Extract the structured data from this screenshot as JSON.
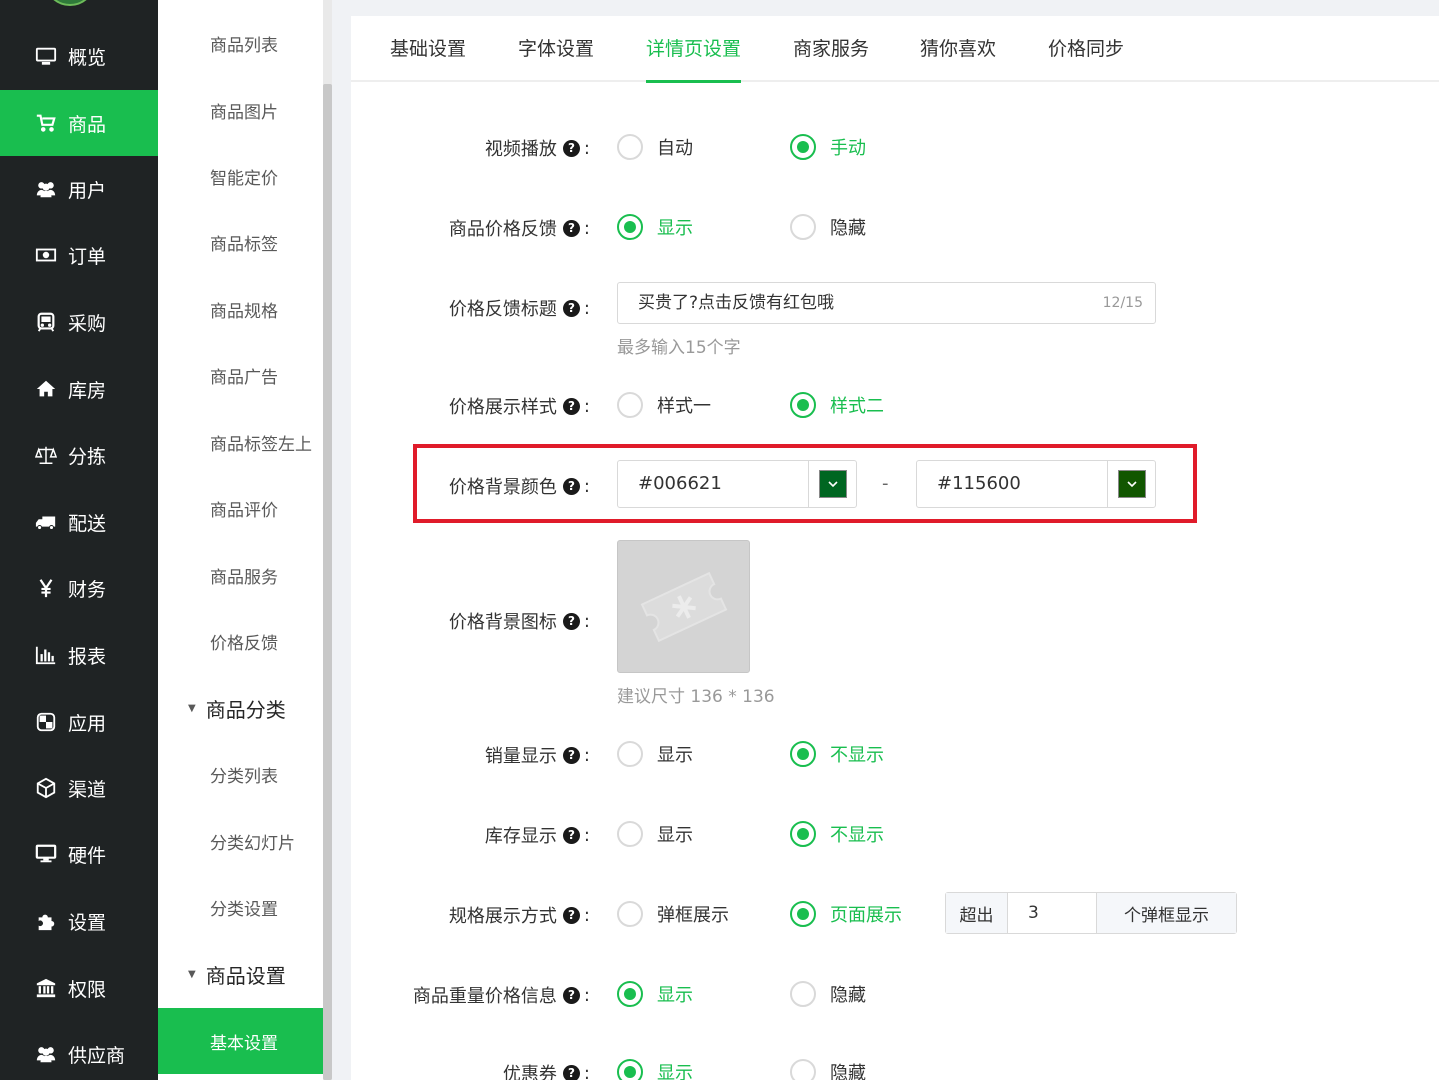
{
  "colors": {
    "brand_green": "#19be4f",
    "sidebar_bg": "#1f2324",
    "highlight_red": "#e01b2a"
  },
  "sidebar": {
    "items": [
      {
        "label": "概览",
        "icon": "monitor-icon"
      },
      {
        "label": "商品",
        "icon": "cart-icon",
        "active": true
      },
      {
        "label": "用户",
        "icon": "users-icon"
      },
      {
        "label": "订单",
        "icon": "money-icon"
      },
      {
        "label": "采购",
        "icon": "truck-front-icon"
      },
      {
        "label": "库房",
        "icon": "home-icon"
      },
      {
        "label": "分拣",
        "icon": "scale-icon"
      },
      {
        "label": "配送",
        "icon": "truck-icon"
      },
      {
        "label": "财务",
        "icon": "yen-icon"
      },
      {
        "label": "报表",
        "icon": "bar-chart-icon"
      },
      {
        "label": "应用",
        "icon": "apps-icon"
      },
      {
        "label": "渠道",
        "icon": "cube-icon"
      },
      {
        "label": "硬件",
        "icon": "desktop-icon"
      },
      {
        "label": "设置",
        "icon": "puzzle-icon"
      },
      {
        "label": "权限",
        "icon": "bank-icon"
      },
      {
        "label": "供应商",
        "icon": "supplier-icon"
      }
    ]
  },
  "submenu": {
    "items": [
      "商品列表",
      "商品图片",
      "智能定价",
      "商品标签",
      "商品规格",
      "商品广告",
      "商品标签左上",
      "商品评价",
      "商品服务",
      "价格反馈"
    ],
    "group1": {
      "label": "商品分类",
      "items": [
        "分类列表",
        "分类幻灯片",
        "分类设置"
      ]
    },
    "group2": {
      "label": "商品设置",
      "items": [
        "基本设置"
      ]
    }
  },
  "tabs": [
    "基础设置",
    "字体设置",
    "详情页设置",
    "商家服务",
    "猜你喜欢",
    "价格同步"
  ],
  "active_tab": "详情页设置",
  "form": {
    "video_play": {
      "label": "视频播放",
      "options": [
        "自动",
        "手动"
      ],
      "selected": "手动"
    },
    "price_feedback": {
      "label": "商品价格反馈",
      "options": [
        "显示",
        "隐藏"
      ],
      "selected": "显示"
    },
    "feedback_title": {
      "label": "价格反馈标题",
      "value": "买贵了?点击反馈有红包哦",
      "count": "12/15",
      "hint": "最多输入15个字"
    },
    "price_style": {
      "label": "价格展示样式",
      "options": [
        "样式一",
        "样式二"
      ],
      "selected": "样式二"
    },
    "price_bg_color": {
      "label": "价格背景颜色",
      "from": "#006621",
      "to": "#115600",
      "separator": "-"
    },
    "price_bg_icon": {
      "label": "价格背景图标",
      "hint": "建议尺寸 136 * 136"
    },
    "sales_display": {
      "label": "销量显示",
      "options": [
        "显示",
        "不显示"
      ],
      "selected": "不显示"
    },
    "stock_display": {
      "label": "库存显示",
      "options": [
        "显示",
        "不显示"
      ],
      "selected": "不显示"
    },
    "spec_display": {
      "label": "规格展示方式",
      "options": [
        "弹框展示",
        "页面展示"
      ],
      "selected": "页面展示",
      "exceed_prefix": "超出",
      "exceed_value": "3",
      "exceed_suffix": "个弹框显示"
    },
    "weight_price": {
      "label": "商品重量价格信息",
      "options": [
        "显示",
        "隐藏"
      ],
      "selected": "显示"
    },
    "coupon": {
      "label": "优惠券",
      "options": [
        "显示",
        "隐藏"
      ],
      "selected": "显示"
    }
  }
}
